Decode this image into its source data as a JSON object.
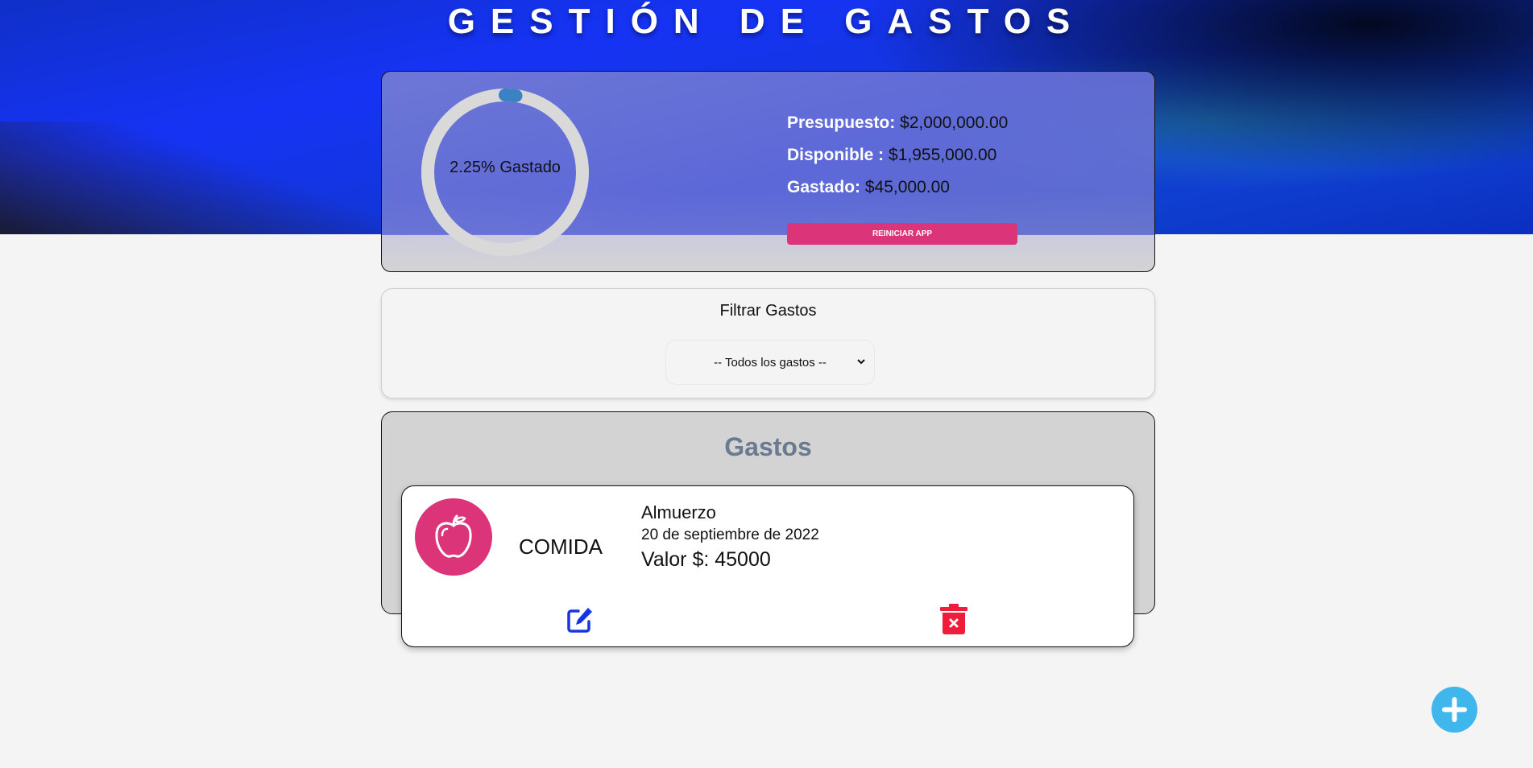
{
  "header": {
    "title": "GESTIÓN DE GASTOS"
  },
  "budget": {
    "percent_label": "2.25% Gastado",
    "percent_spent": 2.25,
    "budget_label": "Presupuesto:",
    "budget_value": "$2,000,000.00",
    "available_label": "Disponible :",
    "available_value": "$1,955,000.00",
    "spent_label": "Gastado:",
    "spent_value": "$45,000.00",
    "reset_label": "REINICIAR APP",
    "ring_color": "#3b82c4",
    "ring_track_color": "#d9d9d9"
  },
  "filter": {
    "title": "Filtrar Gastos",
    "selected": "-- Todos los gastos --"
  },
  "expenses": {
    "title": "Gastos",
    "items": [
      {
        "category": "COMIDA",
        "category_icon": "apple-icon",
        "name": "Almuerzo",
        "date": "20 de septiembre de 2022",
        "value": "Valor $: 45000"
      }
    ]
  },
  "colors": {
    "accent": "#db3478",
    "edit": "#1734e8",
    "delete": "#ef1c3c",
    "add": "#3fb6ec"
  },
  "icons": {
    "edit": "edit-icon",
    "delete": "trash-icon",
    "add": "plus-icon"
  }
}
